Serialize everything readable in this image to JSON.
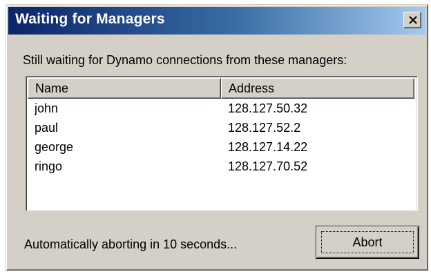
{
  "window": {
    "title": "Waiting for Managers"
  },
  "prompt": "Still waiting for Dynamo connections from these managers:",
  "list": {
    "columns": [
      "Name",
      "Address"
    ],
    "rows": [
      {
        "name": "john",
        "address": "128.127.50.32"
      },
      {
        "name": "paul",
        "address": "128.127.52.2"
      },
      {
        "name": "george",
        "address": "128.127.14.22"
      },
      {
        "name": "ringo",
        "address": "128.127.70.52"
      }
    ]
  },
  "status": "Automatically aborting in 10 seconds...",
  "buttons": {
    "abort_label": "Abort"
  },
  "icons": {
    "close": "close-icon"
  },
  "colors": {
    "titlebar_start": "#0a246a",
    "titlebar_end": "#a6caf0",
    "face": "#d4d0c8"
  }
}
